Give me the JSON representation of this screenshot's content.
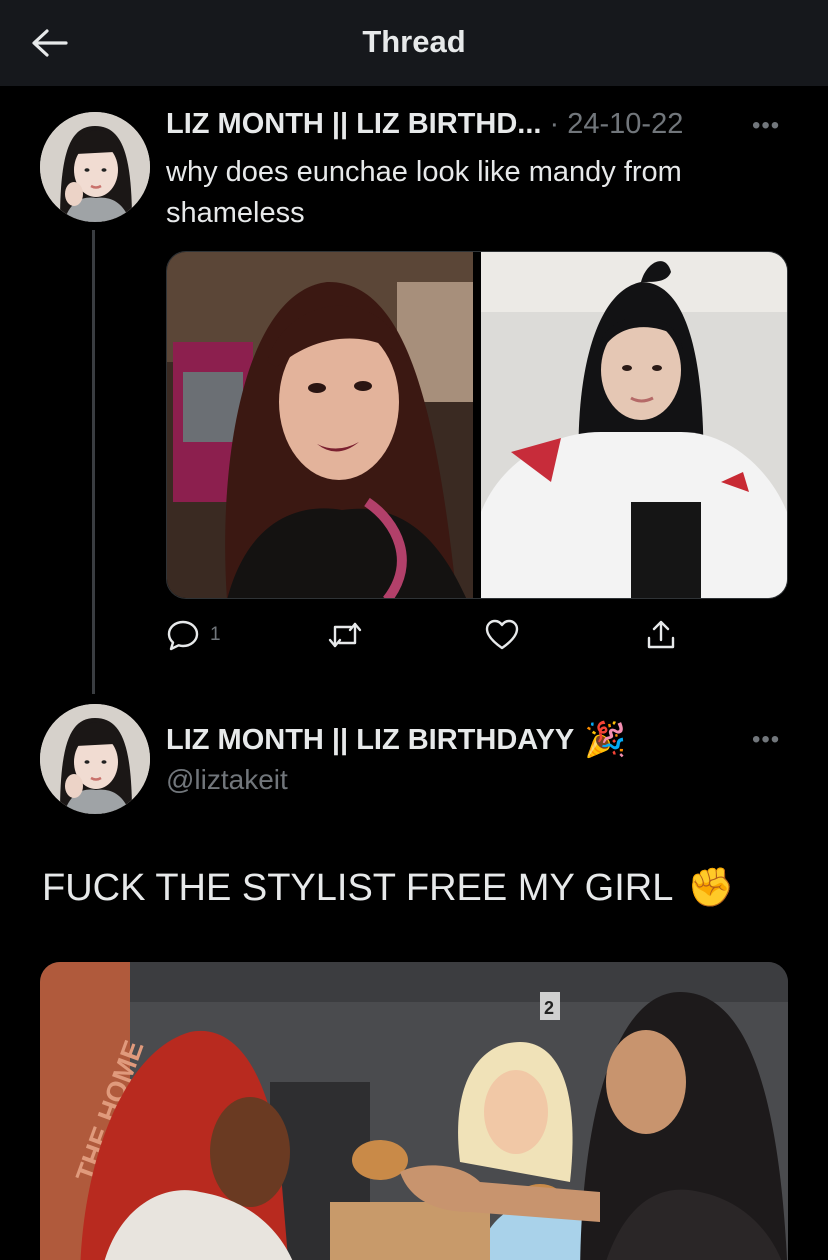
{
  "header": {
    "title": "Thread"
  },
  "tweet1": {
    "author": "LIZ MONTH || LIZ BIRTHD...",
    "date_sep": "·",
    "date": "24-10-22",
    "text": "why does eunchae look like mandy from shameless",
    "media": [
      {
        "label": "photo of woman with auburn bangs"
      },
      {
        "label": "photo of woman with black ponytail in white jacket"
      }
    ],
    "actions": {
      "reply_count": "1"
    }
  },
  "tweet2": {
    "author": "LIZ MONTH || LIZ BIRTHDAYY",
    "author_emoji": "🎉",
    "handle": "@liztakeit",
    "text": "FUCK THE STYLIST FREE MY GIRL",
    "text_emoji": "✊",
    "media_label_box": "2",
    "media_label_crate": "THE HOME"
  },
  "more_label": "•••",
  "colors": {
    "background": "#000000",
    "topbar": "#16181c",
    "text": "#e7e9ea",
    "secondary": "#71767b"
  }
}
